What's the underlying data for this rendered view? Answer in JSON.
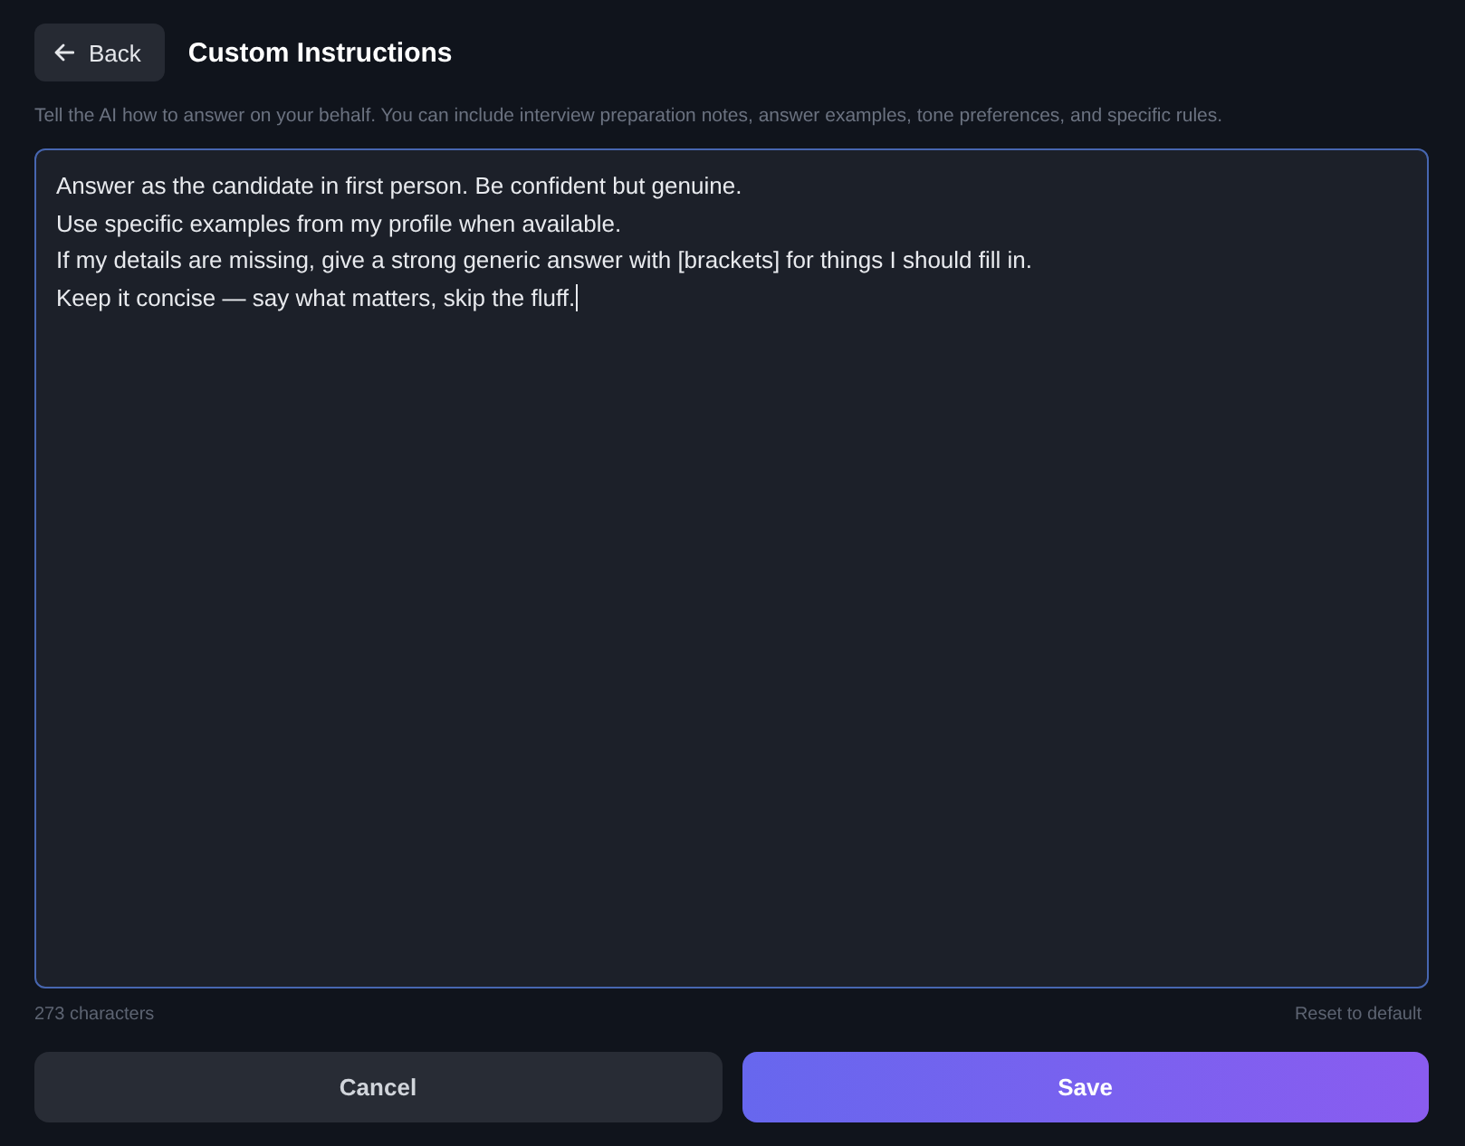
{
  "header": {
    "back_button": {
      "label": "Back"
    },
    "title": "Custom Instructions"
  },
  "description": "Tell the AI how to answer on your behalf. You can include interview preparation notes, answer examples, tone preferences, and specific rules.",
  "editor": {
    "value": "Answer as the candidate in first person. Be confident but genuine.\nUse specific examples from my profile when available.\nIf my details are missing, give a strong generic answer with [brackets] for things I should fill in.\nKeep it concise — say what matters, skip the fluff.",
    "focused": true
  },
  "footer": {
    "char_count": "273 characters",
    "reset_link": "Reset to default"
  },
  "buttons": [
    {
      "label": "Cancel",
      "kind": "secondary"
    },
    {
      "label": "Save",
      "kind": "primary"
    }
  ]
}
